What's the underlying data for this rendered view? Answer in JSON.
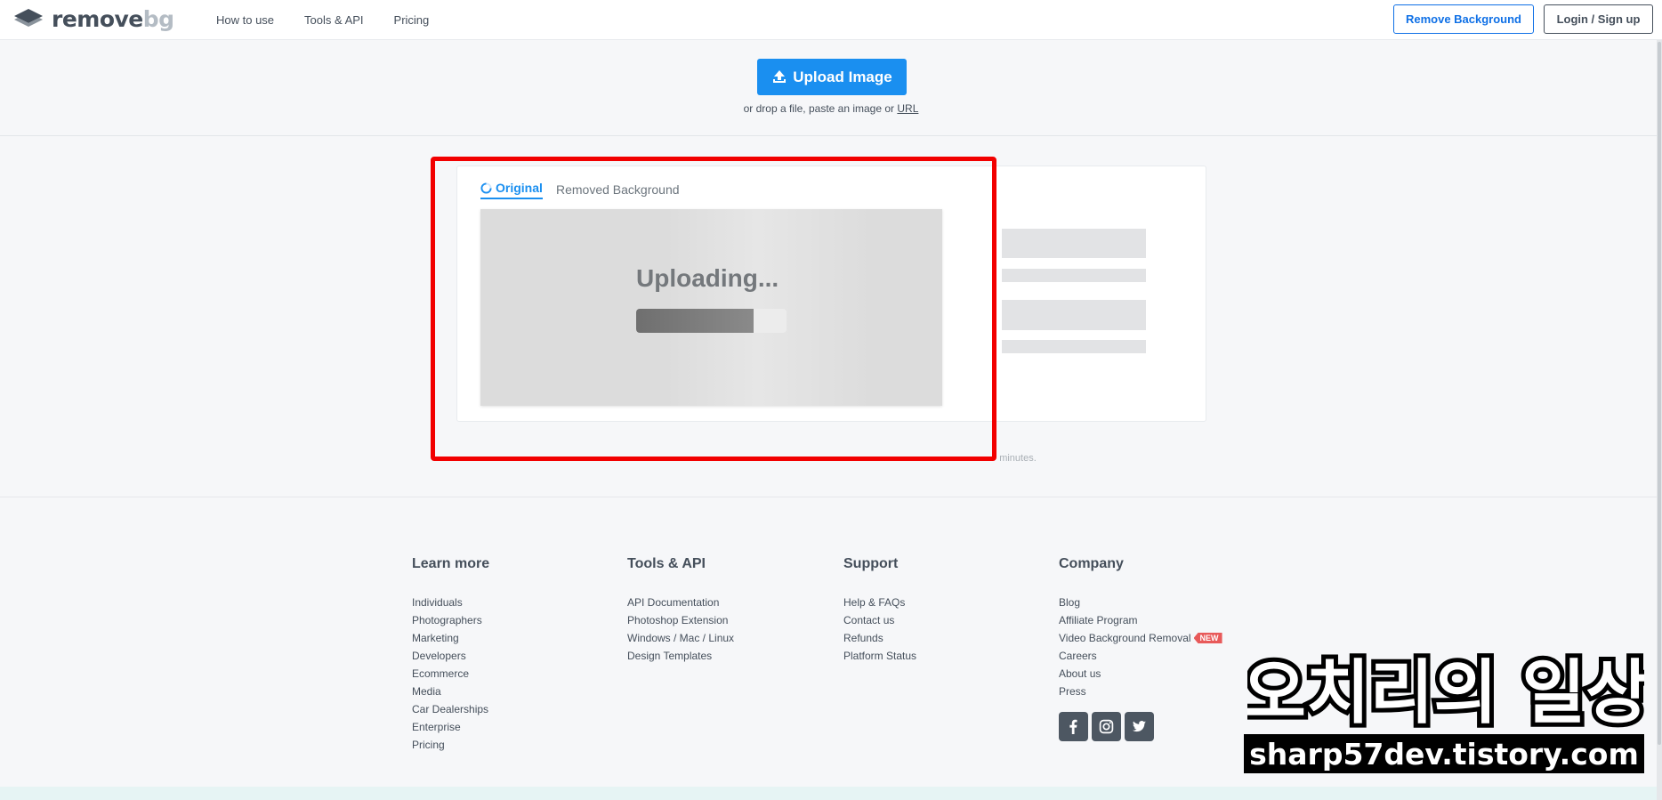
{
  "header": {
    "logo": {
      "part1": "remove",
      "part2": "bg"
    },
    "nav": [
      "How to use",
      "Tools & API",
      "Pricing"
    ],
    "remove_background_label": "Remove Background",
    "login_label": "Login / Sign up"
  },
  "upload": {
    "button_label": "Upload Image",
    "drop_text": "or drop a file, paste an image or",
    "url_link": "URL"
  },
  "result": {
    "tab_original": "Original",
    "tab_removed": "Removed Background",
    "status_text": "Uploading...",
    "progress": 0.78
  },
  "note_tail": "minutes.",
  "footer": {
    "columns": [
      {
        "title": "Learn more",
        "links": [
          "Individuals",
          "Photographers",
          "Marketing",
          "Developers",
          "Ecommerce",
          "Media",
          "Car Dealerships",
          "Enterprise",
          "Pricing"
        ]
      },
      {
        "title": "Tools & API",
        "links": [
          "API Documentation",
          "Photoshop Extension",
          "Windows / Mac / Linux",
          "Design Templates"
        ]
      },
      {
        "title": "Support",
        "links": [
          "Help & FAQs",
          "Contact us",
          "Refunds",
          "Platform Status"
        ]
      },
      {
        "title": "Company",
        "links": [
          "Blog",
          "Affiliate Program",
          "Video Background Removal",
          "Careers",
          "About us",
          "Press"
        ]
      }
    ],
    "new_badge": "NEW",
    "socials": [
      "facebook-icon",
      "instagram-icon",
      "twitter-icon"
    ]
  },
  "watermark": {
    "korean": "오치리의 일상",
    "url": "sharp57dev.tistory.com"
  },
  "colors": {
    "accent": "#1a8ff0",
    "highlight": "#f20000",
    "badge": "#e85a5a"
  }
}
